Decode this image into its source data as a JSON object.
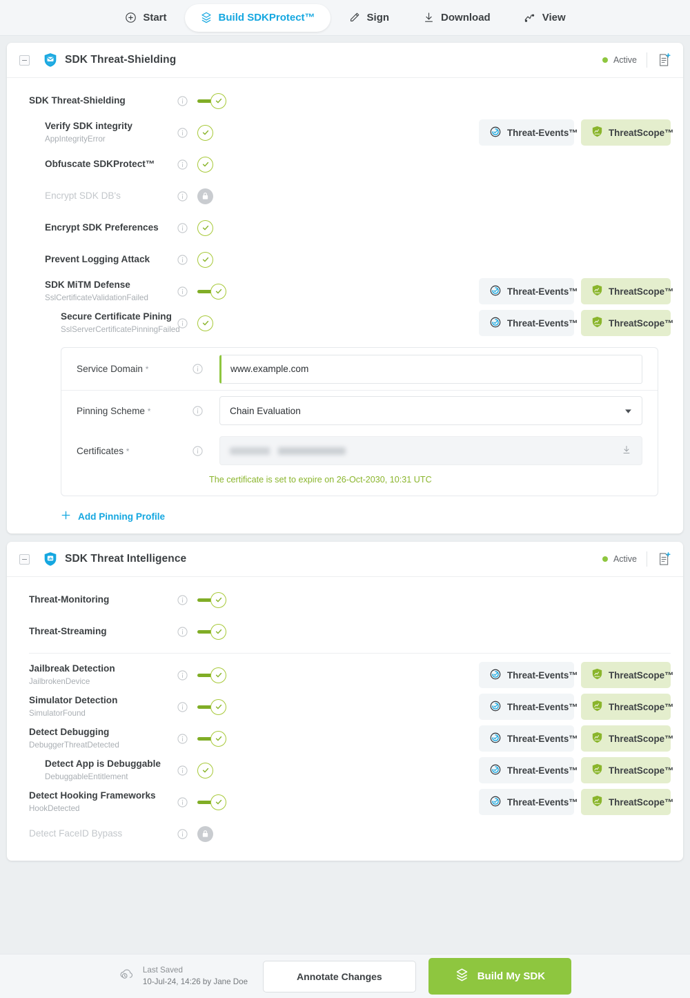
{
  "colors": {
    "accent_blue": "#15a7e0",
    "accent_green": "#8ec63f",
    "toggle_green": "#80ad26",
    "chip_scope_bg": "#e4eecd",
    "chip_events_bg": "#f2f5f7",
    "status_green": "#8ec63f"
  },
  "topnav": {
    "items": [
      {
        "label": "Start",
        "icon": "plus-circle-icon",
        "active": false
      },
      {
        "label": "Build SDKProtect™",
        "icon": "build-layers-icon",
        "active": true
      },
      {
        "label": "Sign",
        "icon": "pen-icon",
        "active": false
      },
      {
        "label": "Download",
        "icon": "download-icon",
        "active": false
      },
      {
        "label": "View",
        "icon": "chart-line-icon",
        "active": false
      }
    ]
  },
  "chips": {
    "threat_events": "Threat-Events™",
    "threat_scope": "ThreatScope™"
  },
  "sections": [
    {
      "id": "sdk-threat-shielding",
      "title": "SDK Threat-Shielding",
      "icon": "shield-envelope-icon",
      "status": "Active",
      "rows": [
        {
          "title": "SDK Threat-Shielding",
          "sub": "",
          "indent": 0,
          "control": "toggle-on",
          "chips": false,
          "disabled": false
        },
        {
          "title": "Verify SDK integrity",
          "sub": "AppIntegrityError",
          "indent": 1,
          "control": "check",
          "chips": true,
          "disabled": false
        },
        {
          "title": "Obfuscate SDKProtect™",
          "sub": "",
          "indent": 1,
          "control": "check",
          "chips": false,
          "disabled": false
        },
        {
          "title": "Encrypt SDK DB's",
          "sub": "",
          "indent": 1,
          "control": "lock",
          "chips": false,
          "disabled": true
        },
        {
          "title": "Encrypt SDK Preferences",
          "sub": "",
          "indent": 1,
          "control": "check",
          "chips": false,
          "disabled": false
        },
        {
          "title": "Prevent Logging Attack",
          "sub": "",
          "indent": 1,
          "control": "check",
          "chips": false,
          "disabled": false
        },
        {
          "title": "SDK MiTM Defense",
          "sub": "SslCertificateValidationFailed",
          "indent": 1,
          "control": "toggle-on",
          "chips": true,
          "disabled": false
        },
        {
          "title": "Secure Certificate Pining",
          "sub": "SslServerCertificatePinningFailed",
          "indent": 2,
          "control": "check",
          "chips": true,
          "disabled": false
        }
      ],
      "form": {
        "service_domain": {
          "label": "Service Domain",
          "required": "*",
          "value": "www.example.com",
          "placeholder": "www.example.com"
        },
        "pinning_scheme": {
          "label": "Pinning Scheme",
          "required": "*",
          "value": "Chain Evaluation",
          "options": [
            "Chain Evaluation"
          ]
        },
        "certificates": {
          "label": "Certificates",
          "required": "*",
          "value": "",
          "note": "The certificate is set to expire on 26-Oct-2030, 10:31 UTC"
        },
        "add_link": "Add Pinning Profile"
      }
    },
    {
      "id": "sdk-threat-intelligence",
      "title": "SDK Threat Intelligence",
      "icon": "shield-monitor-icon",
      "status": "Active",
      "rows": [
        {
          "title": "Threat-Monitoring",
          "sub": "",
          "indent": 0,
          "control": "toggle-on",
          "chips": false,
          "disabled": false
        },
        {
          "title": "Threat-Streaming",
          "sub": "",
          "indent": 0,
          "control": "toggle-on",
          "chips": false,
          "disabled": false
        },
        {
          "title": "Jailbreak Detection",
          "sub": "JailbrokenDevice",
          "indent": 0,
          "control": "toggle-on",
          "chips": true,
          "disabled": false
        },
        {
          "title": "Simulator Detection",
          "sub": "SimulatorFound",
          "indent": 0,
          "control": "toggle-on",
          "chips": true,
          "disabled": false
        },
        {
          "title": "Detect Debugging",
          "sub": "DebuggerThreatDetected",
          "indent": 0,
          "control": "toggle-on",
          "chips": true,
          "disabled": false
        },
        {
          "title": "Detect App is Debuggable",
          "sub": "DebuggableEntitlement",
          "indent": 1,
          "control": "check",
          "chips": true,
          "disabled": false
        },
        {
          "title": "Detect Hooking Frameworks",
          "sub": "HookDetected",
          "indent": 0,
          "control": "toggle-on",
          "chips": true,
          "disabled": false
        },
        {
          "title": "Detect FaceID Bypass",
          "sub": "",
          "indent": 0,
          "control": "lock",
          "chips": false,
          "disabled": true
        }
      ]
    }
  ],
  "footer": {
    "saved_label": "Last Saved",
    "saved_value": "10-Jul-24, 14:26 by Jane Doe",
    "annotate_label": "Annotate Changes",
    "build_label": "Build My SDK"
  }
}
